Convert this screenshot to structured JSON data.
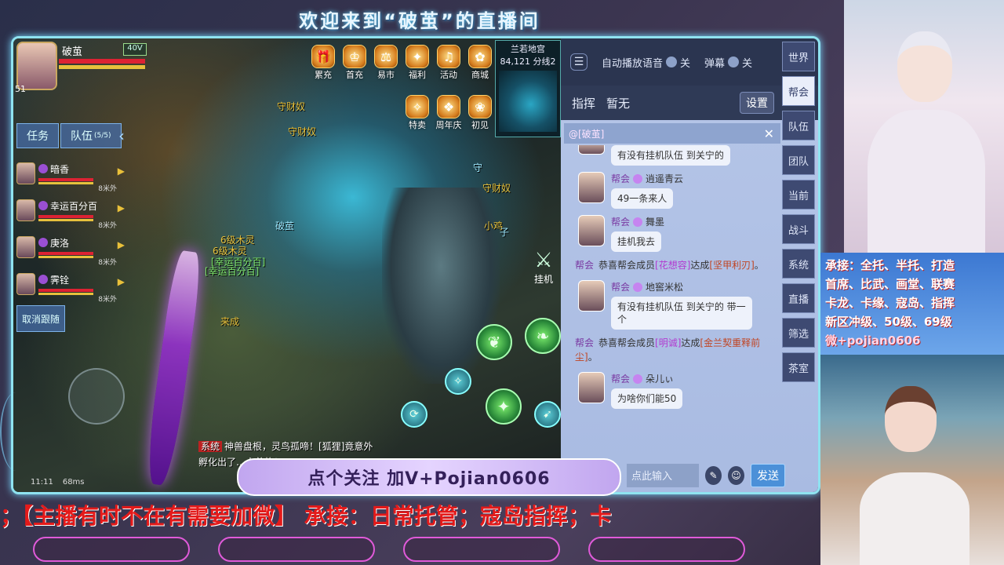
{
  "banner": {
    "title": "欢迎来到“破茧”的直播间"
  },
  "player": {
    "name": "破茧",
    "level": "51",
    "power": "40V",
    "name_tag": "跟"
  },
  "left_tabs": {
    "task": "任务",
    "team": "队伍",
    "team_count": "(5/5)"
  },
  "team": [
    {
      "name": "暗香",
      "level": "8米外"
    },
    {
      "name": "幸运百分百",
      "level": "8米外"
    },
    {
      "name": "庚洛",
      "level": "8米外"
    },
    {
      "name": "霁铨",
      "level": "8米外"
    }
  ],
  "cancel_follow": "取消跟随",
  "status": {
    "time": "11:11",
    "ping": "68ms"
  },
  "functions_row1": [
    {
      "label": "累充",
      "icon": "gift-icon"
    },
    {
      "label": "首充",
      "icon": "crown-icon"
    },
    {
      "label": "易市",
      "icon": "market-icon"
    },
    {
      "label": "福利",
      "icon": "bag-icon"
    },
    {
      "label": "活动",
      "icon": "horn-icon"
    },
    {
      "label": "商城",
      "icon": "shop-icon"
    }
  ],
  "functions_row2": [
    {
      "label": "特卖",
      "icon": "sale-icon"
    },
    {
      "label": "周年庆",
      "icon": "anniversary-icon"
    },
    {
      "label": "初见",
      "icon": "meet-icon"
    }
  ],
  "minimap": {
    "location": "兰若地宫",
    "coords": "84,121 分线2"
  },
  "npcs": {
    "guard1": "守财奴",
    "guard2": "守财奴",
    "guard3": "守财奴",
    "player_tag": "破茧",
    "lv6_spirit": "6级木灵",
    "lv6_wood": "6级木灵",
    "lucky_tag": "[幸运百分百]",
    "lucky_tag2": "[幸运百分百]",
    "xiaoji": "小鸡",
    "laicheng": "来成",
    "shou": "守",
    "zi": "子"
  },
  "auto_button": "挂机",
  "system_msg": {
    "tag": "系统",
    "text": "神兽盘根，灵鸟孤啼！[狐狸]竟意外孵化出了…人羡艳！"
  },
  "chat": {
    "auto_voice_label": "自动播放语音",
    "auto_voice_state": "关",
    "barrage_label": "弹幕",
    "barrage_state": "关",
    "commander_label": "指挥",
    "commander_value": "暂无",
    "settings": "设置",
    "filter_tag": "@[破茧]",
    "messages": [
      {
        "text": "有没有挂机队伍 到关宁的",
        "channel": "",
        "name": ""
      },
      {
        "channel": "帮会",
        "name": "逍遥青云",
        "text": "49一条来人"
      },
      {
        "channel": "帮会",
        "name": "舞墨",
        "text": "挂机我去"
      }
    ],
    "sys1": {
      "channel": "帮会",
      "prefix": "恭喜帮会成员",
      "member": "[花想容]",
      "mid": "达成",
      "achievement": "[坚甲利刃]",
      "end": "。"
    },
    "messages2": [
      {
        "channel": "帮会",
        "name": "地窖米松",
        "text": "有没有挂机队伍 到关宁的 带一个"
      }
    ],
    "sys2": {
      "channel": "帮会",
      "prefix": "恭喜帮会成员",
      "member": "[明诚]",
      "mid": "达成",
      "achievement": "[金兰契重释前尘]",
      "end": "。"
    },
    "messages3": [
      {
        "channel": "帮会",
        "name": "朵儿ぃ",
        "text": "为啥你们能50"
      }
    ],
    "input_placeholder": "点此输入",
    "send": "发送",
    "channels": [
      "世界",
      "帮会",
      "队伍",
      "团队",
      "当前",
      "战斗",
      "系统",
      "直播",
      "筛选",
      "茶室"
    ],
    "active_channel": "帮会"
  },
  "overlay": {
    "follow_text": "点个关注  加V+Pojian0606"
  },
  "ticker": {
    "text": "；【主播有时不在有需要加微】 承接：日常托管；寇岛指挥；卡"
  },
  "promo": {
    "line1": "承接：全托、半托、打造",
    "line2": "首席、比武、画堂、联赛",
    "line3": "卡龙、卡缘、寇岛、指挥",
    "line4": "新区冲级、50级、69级",
    "line5": "微+pojian0606"
  },
  "colors": {
    "frame": "#8fe3f0",
    "ticker": "#e41a1a",
    "chat_bg": "#b6c6e8",
    "accent_purple": "#7a3aa2"
  }
}
